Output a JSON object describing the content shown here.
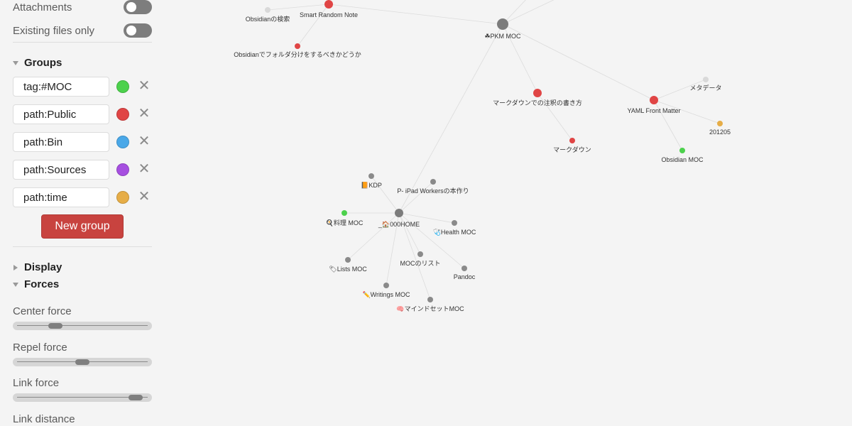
{
  "filters": {
    "attachments_label": "Attachments",
    "attachments_on": false,
    "existing_files_label": "Existing files only",
    "existing_files_on": false
  },
  "groups": {
    "header": "Groups",
    "items": [
      {
        "query": "tag:#MOC",
        "color": "#4cd14c"
      },
      {
        "query": "path:Public",
        "color": "#e04545"
      },
      {
        "query": "path:Bin",
        "color": "#4aa8e8"
      },
      {
        "query": "path:Sources",
        "color": "#a64fe0"
      },
      {
        "query": "path:time",
        "color": "#e6ad47"
      }
    ],
    "remove_icon": "close-icon",
    "new_group_label": "New group"
  },
  "display": {
    "header": "Display"
  },
  "forces": {
    "header": "Forces",
    "center_label": "Center force",
    "center_value": 0.27,
    "repel_label": "Repel force",
    "repel_value": 0.5,
    "link_label": "Link force",
    "link_value": 0.96,
    "distance_label": "Link distance"
  },
  "graph": {
    "nodes": [
      {
        "id": "hub-top",
        "label": "",
        "color": "#808080"
      },
      {
        "id": "obs-search",
        "label": "Obsidianの検索",
        "color": "#d9d9d9"
      },
      {
        "id": "smart-random",
        "label": "Smart Random Note",
        "color": "#e04545"
      },
      {
        "id": "obs-folder",
        "label": "Obsidianでフォルダ分けをするべきかどうか",
        "color": "#e04545"
      },
      {
        "id": "pkm",
        "label": "☘PKM MOC",
        "color": "#7c7c7c"
      },
      {
        "id": "md-note",
        "label": "マークダウンでの注釈の書き方",
        "color": "#e04545"
      },
      {
        "id": "md",
        "label": "マークダウン",
        "color": "#e04545"
      },
      {
        "id": "yaml",
        "label": "YAML Front Matter",
        "color": "#e04545"
      },
      {
        "id": "meta",
        "label": "メタデータ",
        "color": "#d9d9d9"
      },
      {
        "id": "d201205",
        "label": "201205",
        "color": "#e6ad47"
      },
      {
        "id": "obs-moc",
        "label": "Obsidian MOC",
        "color": "#4cd14c"
      },
      {
        "id": "kdp",
        "label": "📙KDP",
        "color": "#8a8a8a"
      },
      {
        "id": "ipad",
        "label": "P- iPad Workersの本作り",
        "color": "#8a8a8a"
      },
      {
        "id": "ryori",
        "label": "🍳料理 MOC",
        "color": "#4cd14c"
      },
      {
        "id": "home",
        "label": "_🏠000HOME",
        "color": "#7c7c7c"
      },
      {
        "id": "health",
        "label": "🩺Health MOC",
        "color": "#8a8a8a"
      },
      {
        "id": "lists",
        "label": "🏷Lists MOC",
        "color": "#8a8a8a"
      },
      {
        "id": "moc-list",
        "label": "MOCのリスト",
        "color": "#8a8a8a"
      },
      {
        "id": "pandoc",
        "label": "Pandoc",
        "color": "#8a8a8a"
      },
      {
        "id": "writings",
        "label": "✏️Writings MOC",
        "color": "#8a8a8a"
      },
      {
        "id": "mindset",
        "label": "🧠マインドセットMOC",
        "color": "#8a8a8a"
      }
    ],
    "edges": [
      [
        "hub-top",
        "smart-random"
      ],
      [
        "hub-top",
        "obs-search"
      ],
      [
        "hub-top",
        "obs-folder"
      ],
      [
        "pkm",
        "md-note"
      ],
      [
        "pkm",
        "yaml"
      ],
      [
        "pkm",
        "home"
      ],
      [
        "md-note",
        "md"
      ],
      [
        "yaml",
        "meta"
      ],
      [
        "yaml",
        "d201205"
      ],
      [
        "yaml",
        "obs-moc"
      ],
      [
        "home",
        "kdp"
      ],
      [
        "home",
        "ipad"
      ],
      [
        "home",
        "ryori"
      ],
      [
        "home",
        "health"
      ],
      [
        "home",
        "lists"
      ],
      [
        "home",
        "moc-list"
      ],
      [
        "home",
        "pandoc"
      ],
      [
        "home",
        "writings"
      ],
      [
        "home",
        "mindset"
      ]
    ]
  }
}
